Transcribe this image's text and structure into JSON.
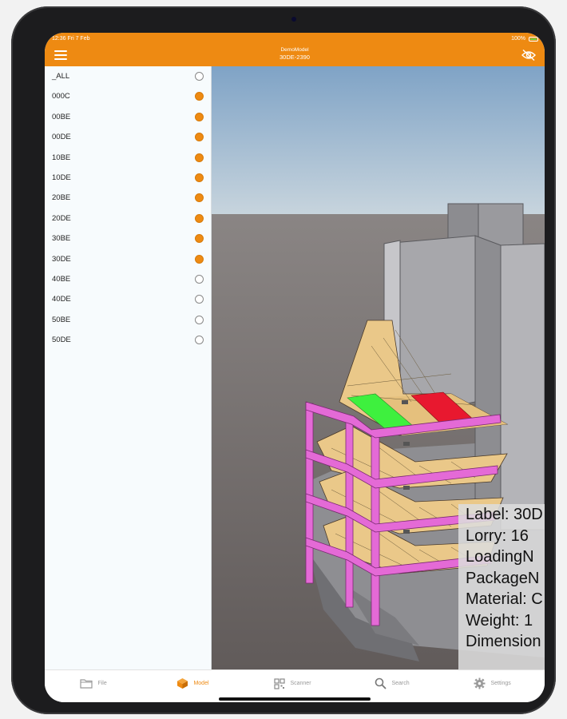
{
  "status": {
    "time": "12:36",
    "date": "Fri 7 Feb",
    "battery": "100%"
  },
  "header": {
    "title": "DemoModel",
    "subtitle": "30DE-2390",
    "menu_icon": "hamburger-menu-icon",
    "visibility_icon": "eye-slash-icon"
  },
  "colors": {
    "accent": "#ee8a12",
    "header_bg": "#ee8a12",
    "sidebar_bg": "#f7fbfd",
    "beam": "#e46ad6",
    "slab": "#eac889",
    "highlight_green": "#3ef03e",
    "highlight_red": "#e8182f"
  },
  "layers": [
    {
      "label": "_ALL",
      "checked": false
    },
    {
      "label": "000C",
      "checked": true
    },
    {
      "label": "00BE",
      "checked": true
    },
    {
      "label": "00DE",
      "checked": true
    },
    {
      "label": "10BE",
      "checked": true
    },
    {
      "label": "10DE",
      "checked": true
    },
    {
      "label": "20BE",
      "checked": true
    },
    {
      "label": "20DE",
      "checked": true
    },
    {
      "label": "30BE",
      "checked": true
    },
    {
      "label": "30DE",
      "checked": true
    },
    {
      "label": "40BE",
      "checked": false
    },
    {
      "label": "40DE",
      "checked": false
    },
    {
      "label": "50BE",
      "checked": false
    },
    {
      "label": "50DE",
      "checked": false
    }
  ],
  "info_panel": {
    "lines": [
      "Label: 30D",
      "Lorry: 16",
      "LoadingN",
      "PackageN",
      "Material: C",
      "Weight: 1",
      "Dimension"
    ]
  },
  "tabs": [
    {
      "label": "File",
      "icon": "folder-icon",
      "active": false
    },
    {
      "label": "Model",
      "icon": "box-icon",
      "active": true
    },
    {
      "label": "Scanner",
      "icon": "qr-code-icon",
      "active": false
    },
    {
      "label": "Search",
      "icon": "search-icon",
      "active": false
    },
    {
      "label": "Settings",
      "icon": "gear-icon",
      "active": false
    }
  ]
}
